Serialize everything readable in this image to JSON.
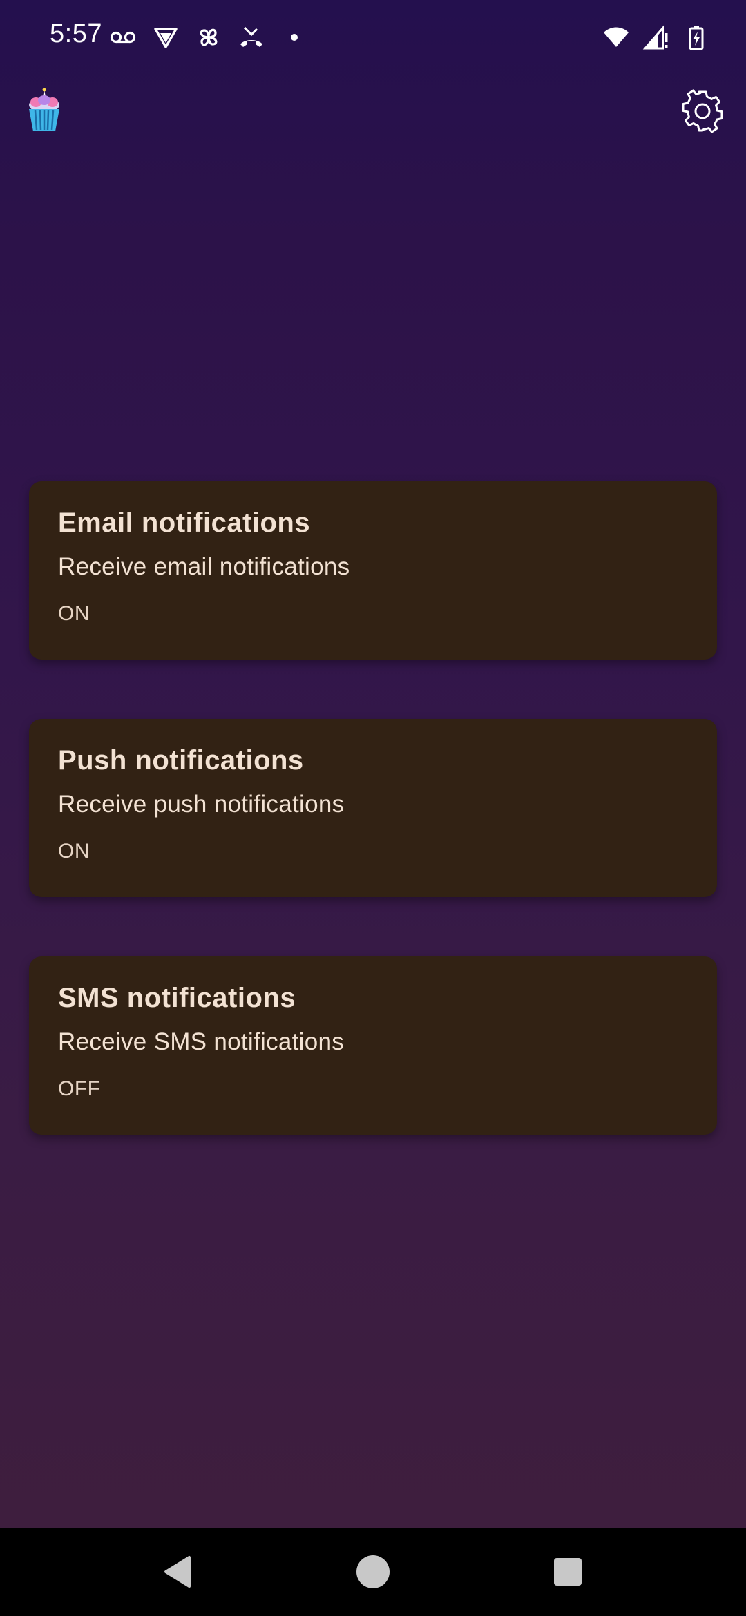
{
  "status_bar": {
    "time": "5:57",
    "left_icons": [
      "voicemail-icon",
      "vpn-shield-icon",
      "pinwheel-icon",
      "missed-call-icon",
      "dot-icon"
    ],
    "right_icons": [
      "wifi-icon",
      "cell-signal-icon",
      "battery-charging-icon"
    ]
  },
  "header": {
    "logo_icon": "cupcake-icon",
    "settings_icon": "gear-icon"
  },
  "cards": [
    {
      "title": "Email notifications",
      "description": "Receive email notifications",
      "state": "ON"
    },
    {
      "title": "Push notifications",
      "description": "Receive push notifications",
      "state": "ON"
    },
    {
      "title": "SMS notifications",
      "description": "Receive SMS notifications",
      "state": "OFF"
    }
  ],
  "nav_bar": {
    "back_icon": "back-triangle-icon",
    "home_icon": "home-circle-icon",
    "recents_icon": "recents-square-icon"
  },
  "colors": {
    "background_top": "#24104e",
    "background_bottom": "#3f1e3c",
    "card_background": "#322214",
    "card_text": "#f3e2d3"
  }
}
